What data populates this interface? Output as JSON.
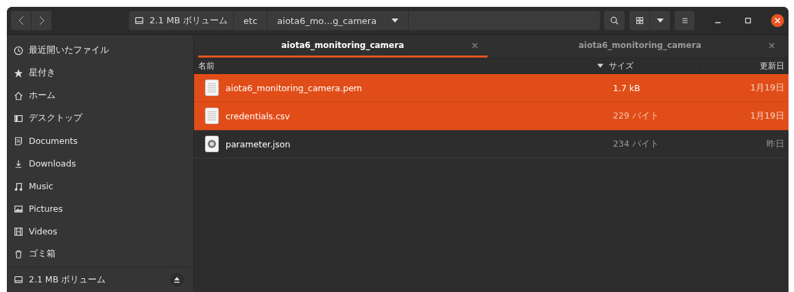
{
  "header": {
    "path": [
      {
        "label": "2.1 MB ボリューム",
        "kind": "drive"
      },
      {
        "label": "etc",
        "kind": "folder"
      },
      {
        "label": "aiota6_mo…g_camera",
        "kind": "menu"
      }
    ]
  },
  "sidebar": {
    "items": [
      {
        "label": "最近開いたファイル",
        "kind": "recent",
        "selected": false
      },
      {
        "label": "星付き",
        "kind": "star",
        "selected": false
      },
      {
        "label": "ホーム",
        "kind": "home",
        "selected": false
      },
      {
        "label": "デスクトップ",
        "kind": "desktop",
        "selected": false
      },
      {
        "label": "Documents",
        "kind": "documents",
        "selected": false
      },
      {
        "label": "Downloads",
        "kind": "downloads",
        "selected": false
      },
      {
        "label": "Music",
        "kind": "music",
        "selected": false
      },
      {
        "label": "Pictures",
        "kind": "pictures",
        "selected": false
      },
      {
        "label": "Videos",
        "kind": "videos",
        "selected": false
      },
      {
        "label": "ゴミ箱",
        "kind": "trash",
        "selected": false
      }
    ],
    "devices": [
      {
        "label": "2.1 MB ボリューム"
      }
    ]
  },
  "tabs": [
    {
      "label": "aiota6_monitoring_camera",
      "selected": true
    },
    {
      "label": "aiota6_monitoring_camera",
      "selected": false
    }
  ],
  "table": {
    "columns": [
      "名前",
      "サイズ",
      "更新日"
    ],
    "rows": [
      {
        "name": "aiota6_monitoring_camera.pem",
        "kind": "text",
        "size": "1.7 kB",
        "date": "1月19日",
        "selected": true
      },
      {
        "name": "credentials.csv",
        "kind": "text",
        "size": "229 バイト",
        "date": "1月19日",
        "selected": true
      },
      {
        "name": "parameter.json",
        "kind": "json",
        "size": "234 バイト",
        "date": "昨日",
        "selected": false
      }
    ]
  }
}
